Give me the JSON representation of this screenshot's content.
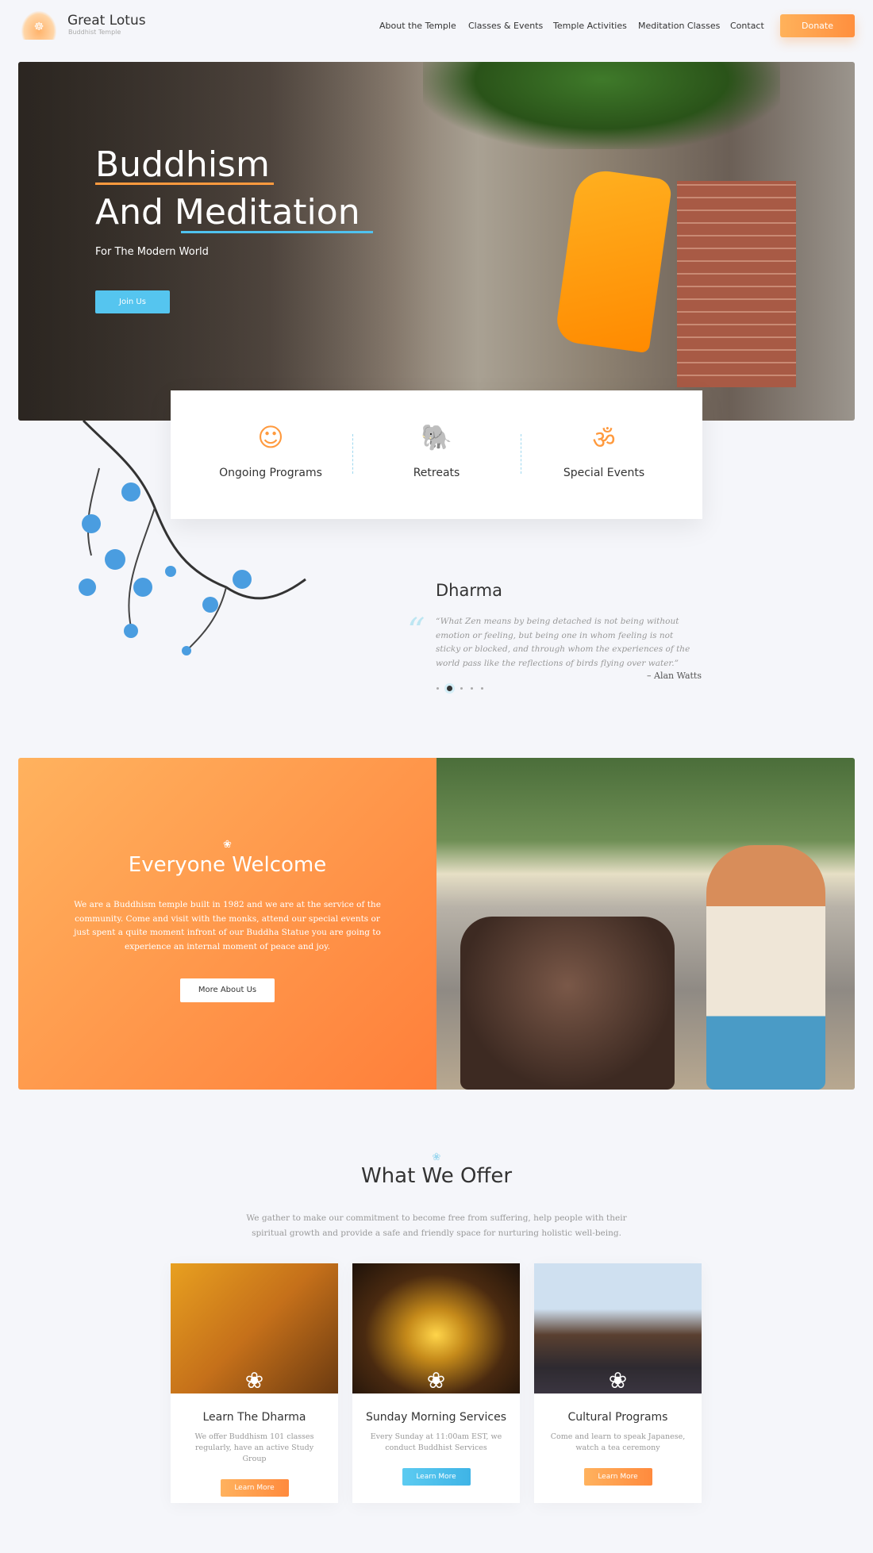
{
  "brand": {
    "name": "Great Lotus",
    "tagline": "Buddhist Temple"
  },
  "nav": {
    "items": [
      "About the Temple",
      "Classes & Events",
      "Temple Activities",
      "Meditation Classes",
      "Contact"
    ],
    "donate": "Donate"
  },
  "hero": {
    "line1": "Buddhism",
    "line2": "And Meditation",
    "subtitle": "For The Modern World",
    "button": "Join Us"
  },
  "categories": [
    {
      "icon": "monk-icon",
      "label": "Ongoing Programs"
    },
    {
      "icon": "elephant-icon",
      "label": "Retreats"
    },
    {
      "icon": "om-icon",
      "label": "Special Events"
    }
  ],
  "dharma": {
    "title": "Dharma",
    "quote": "“What Zen means by being detached is not being without emotion or feeling, but being one in whom feeling is not sticky or blocked, and through whom the experiences of the world pass like the reflections of birds flying over water.”",
    "author": "– Alan Watts",
    "slides": 5,
    "active_slide": 2
  },
  "welcome": {
    "title": "Everyone Welcome",
    "text": "We are a Buddhism temple built in 1982 and we are at the service of the community. Come and visit with the monks, attend our special events or just spent a quite moment infront of our Buddha Statue you are going to experience an internal moment of peace and joy.",
    "button": "More About Us"
  },
  "offer": {
    "title": "What We Offer",
    "description": "We gather to make our commitment to become free from suffering, help people with their spiritual growth and provide a safe and friendly space for nurturing holistic well-being.",
    "cards": [
      {
        "title": "Learn The Dharma",
        "text": "We offer Buddhism 101 classes regularly, have an active Study Group",
        "button": "Learn More",
        "color": "#ff9a45"
      },
      {
        "title": "Sunday Morning Services",
        "text": "Every Sunday at 11:00am EST, we conduct Buddhist Services",
        "button": "Learn More",
        "color": "#4fc2ef"
      },
      {
        "title": "Cultural Programs",
        "text": "Come and learn to speak Japanese, watch a tea ceremony",
        "button": "Learn More",
        "color": "#ff9a45"
      }
    ]
  },
  "colors": {
    "accent_orange": "#ff9a3e",
    "accent_blue": "#4fc2ef",
    "background": "#f5f6fa"
  }
}
